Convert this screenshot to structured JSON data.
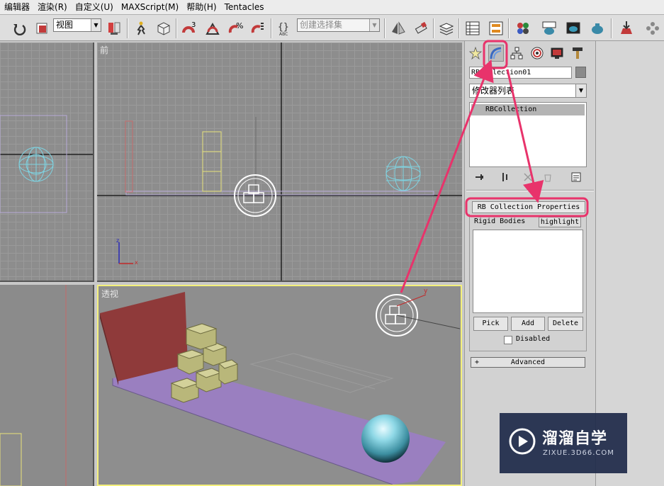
{
  "menubar": {
    "items": [
      "编辑器",
      "渲染(R)",
      "自定义(U)",
      "MAXScript(M)",
      "帮助(H)",
      "Tentacles"
    ]
  },
  "toolbar": {
    "view_combo": "视图",
    "selection_set_placeholder": "创建选择集",
    "icons": [
      "undo-icon",
      "select-icon",
      "select-link-icon",
      "move-icon",
      "object-icon",
      "snap-3-icon",
      "angle-snap-icon",
      "percent-snap-icon",
      "spinner-snap-icon",
      "named-sets-icon",
      "mirror-icon",
      "align-icon",
      "layers-icon",
      "curve-editor-icon",
      "schematic-icon",
      "material-editor-icon",
      "render-setup-icon",
      "render-frame-icon",
      "quick-render-icon",
      "reactor-icon",
      "particle-icon"
    ]
  },
  "viewports": {
    "front_label": "前",
    "perspective_label": "透视",
    "axis_z": "z",
    "axis_x": "x",
    "axis_y": "y"
  },
  "command_panel": {
    "tabs": [
      "create-tab-icon",
      "modify-tab-icon",
      "hierarchy-tab-icon",
      "motion-tab-icon",
      "display-tab-icon",
      "utilities-tab-icon"
    ],
    "object_name": "RBCollection01",
    "modifier_list": "修改器列表",
    "stack_item": "RBCollection",
    "rollout_title": "RB Collection Properties",
    "rigid_bodies_label": "Rigid Bodies",
    "highlight_button": "highlight",
    "pick_button": "Pick",
    "add_button": "Add",
    "delete_button": "Delete",
    "disabled_label": "Disabled",
    "disabled_checked": false,
    "advanced_rollout": "Advanced",
    "advanced_prefix": "+"
  },
  "watermark": {
    "title": "溜溜自学",
    "subtitle": "ZIXUE.3D66.COM"
  },
  "colors": {
    "annotation": "#e8336b",
    "viewport_bg": "#8d8d8d",
    "active_border": "#f4f07a",
    "ground_plane": "#9a7fc0",
    "wall": "#8f3a3a",
    "boxes": "#b9b77a",
    "sphere": "#7fd2e0"
  }
}
